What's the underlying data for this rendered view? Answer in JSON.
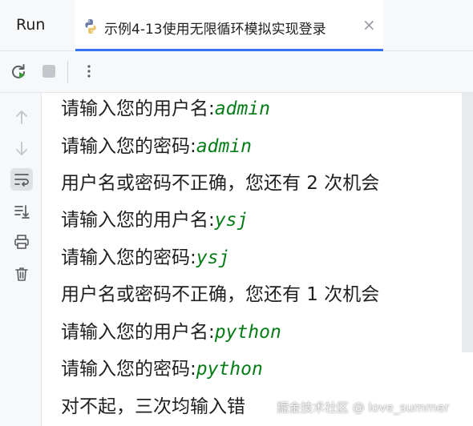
{
  "header": {
    "run_label": "Run",
    "tab_title": "示例4-13使用无限循环模拟实现登录",
    "tab_close": "×",
    "tab_icon": "python-file-icon"
  },
  "toolbar": {
    "buttons": [
      {
        "name": "rerun-icon"
      },
      {
        "name": "stop-icon"
      },
      {
        "name": "more-options-icon",
        "label": "⋮"
      }
    ]
  },
  "sidebar": {
    "buttons": [
      {
        "name": "up-arrow-icon"
      },
      {
        "name": "down-arrow-icon"
      },
      {
        "name": "soft-wrap-icon",
        "active": true
      },
      {
        "name": "scroll-to-end-icon"
      },
      {
        "name": "print-icon"
      },
      {
        "name": "trash-icon"
      }
    ]
  },
  "console": {
    "lines": [
      {
        "prompt": "请输入您的用户名:",
        "input": "admin"
      },
      {
        "prompt": "请输入您的密码:",
        "input": "admin"
      },
      {
        "text": "用户名或密码不正确，您还有 2 次机会"
      },
      {
        "prompt": "请输入您的用户名:",
        "input": "ysj"
      },
      {
        "prompt": "请输入您的密码:",
        "input": "ysj"
      },
      {
        "text": "用户名或密码不正确，您还有 1 次机会"
      },
      {
        "prompt": "请输入您的用户名:",
        "input": "python"
      },
      {
        "prompt": "请输入您的密码:",
        "input": "python"
      },
      {
        "text": "对不起，三次均输入错"
      }
    ]
  },
  "watermark": "掘金技术社区 @ love_summer",
  "colors": {
    "accent": "#3574f0",
    "input_text": "#067d17",
    "panel_bg": "#f7f8fa"
  }
}
